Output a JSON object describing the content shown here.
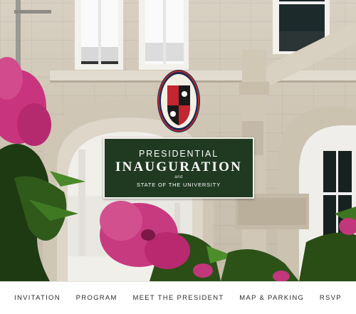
{
  "hero": {
    "title_line1": "PRESIDENTIAL",
    "title_line2": "INAUGURATION",
    "title_and": "and",
    "title_line3": "STATE OF THE UNIVERSITY"
  },
  "nav": {
    "items": [
      {
        "label": "INVITATION"
      },
      {
        "label": "PROGRAM"
      },
      {
        "label": "MEET THE PRESIDENT"
      },
      {
        "label": "MAP & PARKING"
      },
      {
        "label": "RSVP"
      }
    ]
  },
  "colors": {
    "title_bg": "#203a22",
    "stone": "#d2c9b9",
    "blossom": "#c2337a",
    "nav_text": "#2b2b2b"
  }
}
